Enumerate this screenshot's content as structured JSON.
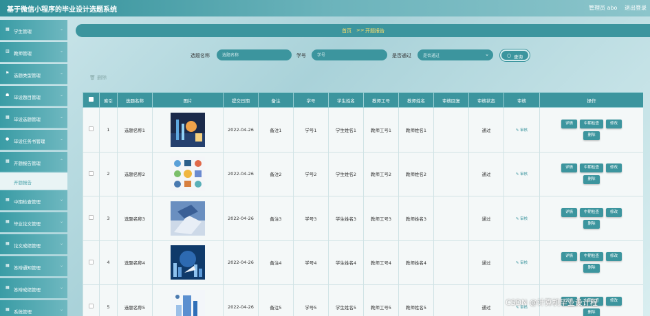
{
  "header": {
    "title": "基于微信小程序的毕业设计选题系统",
    "user": "管理员 abo",
    "logout": "退出登录"
  },
  "sidebar": {
    "items": [
      {
        "label": "学生管理",
        "icon": "grid-icon"
      },
      {
        "label": "教师管理",
        "icon": "chart-icon"
      },
      {
        "label": "选题类型管理",
        "icon": "flag-icon"
      },
      {
        "label": "毕设题目管理",
        "icon": "user-icon"
      },
      {
        "label": "毕设选题管理",
        "icon": "grid-icon"
      },
      {
        "label": "毕设任务书管理",
        "icon": "pin-icon"
      },
      {
        "label": "开题报告管理",
        "icon": "grid-icon",
        "sub": "开题报告"
      },
      {
        "label": "中期检查管理",
        "icon": "grid-icon"
      },
      {
        "label": "毕业论文管理",
        "icon": "grid-icon"
      },
      {
        "label": "论文成绩管理",
        "icon": "grid-icon"
      },
      {
        "label": "答辩通知管理",
        "icon": "grid-icon"
      },
      {
        "label": "答辩成绩管理",
        "icon": "grid-icon"
      },
      {
        "label": "系统管理",
        "icon": "grid-icon"
      }
    ]
  },
  "breadcrumb": {
    "home": "首页",
    "sep": ">>",
    "current": "开题报告"
  },
  "search": {
    "topic_label": "选题名称",
    "topic_placeholder": "选题名称",
    "sid_label": "学号",
    "sid_placeholder": "学号",
    "pass_label": "是否通过",
    "pass_value": "是否通过",
    "query": "查询"
  },
  "toolbar": {
    "delete": "删除"
  },
  "table": {
    "headers": [
      "索引",
      "选题名称",
      "图片",
      "提交日期",
      "备注",
      "学号",
      "学生姓名",
      "教师工号",
      "教师姓名",
      "审核回复",
      "审核状态",
      "审核",
      "操作"
    ],
    "rows": [
      {
        "index": "1",
        "name": "选题名称1",
        "date": "2022-04-26",
        "note": "备注1",
        "sid": "学号1",
        "sname": "学生姓名1",
        "tid": "教师工号1",
        "tname": "教师姓名1",
        "reply": "",
        "status": "通过",
        "audit": "审核"
      },
      {
        "index": "2",
        "name": "选题名称2",
        "date": "2022-04-26",
        "note": "备注2",
        "sid": "学号2",
        "sname": "学生姓名2",
        "tid": "教师工号2",
        "tname": "教师姓名2",
        "reply": "",
        "status": "通过",
        "audit": "审核"
      },
      {
        "index": "3",
        "name": "选题名称3",
        "date": "2022-04-26",
        "note": "备注3",
        "sid": "学号3",
        "sname": "学生姓名3",
        "tid": "教师工号3",
        "tname": "教师姓名3",
        "reply": "",
        "status": "通过",
        "audit": "审核"
      },
      {
        "index": "4",
        "name": "选题名称4",
        "date": "2022-04-26",
        "note": "备注4",
        "sid": "学号4",
        "sname": "学生姓名4",
        "tid": "教师工号4",
        "tname": "教师姓名4",
        "reply": "",
        "status": "通过",
        "audit": "审核"
      },
      {
        "index": "5",
        "name": "选题名称5",
        "date": "2022-04-26",
        "note": "备注5",
        "sid": "学号5",
        "sname": "学生姓名5",
        "tid": "教师工号5",
        "tname": "教师姓名5",
        "reply": "",
        "status": "通过",
        "audit": "审核"
      }
    ],
    "actions": {
      "detail": "详情",
      "midcheck": "中期检查",
      "edit": "修改",
      "delete": "删除"
    }
  },
  "watermark": "CSDN @计算机毕业设计程",
  "colors": {
    "accent": "#3c959e",
    "header": "#2f8f98",
    "crumb_text": "#ffdf6a"
  }
}
